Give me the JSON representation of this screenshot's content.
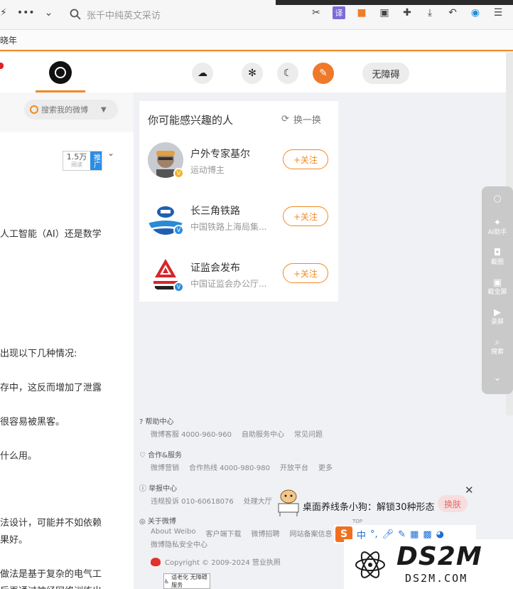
{
  "browser": {
    "address_placeholder": "张千中纯英文采访",
    "bookmark_text": "晓年"
  },
  "header": {
    "accessibility_label": "无障碍"
  },
  "left": {
    "search_placeholder": "搜索我的微博",
    "read_count": "1.5万",
    "read_label": "阅读",
    "promote_label": "推广",
    "article_lines": [
      "人工智能（AI）还是数学",
      "出现以下几种情况:",
      "存中，这反而增加了泄露",
      "很容易被黑客。",
      "什么用。",
      "法设计，可能并不如依赖",
      "果好。",
      "做法是基于复杂的电气工",
      "后再通过神经网络训练出"
    ]
  },
  "recommend": {
    "title": "你可能感兴趣的人",
    "refresh_label": "换一换",
    "follow_label": "+关注",
    "users": [
      {
        "name": "户外专家基尔",
        "desc": "运动博主"
      },
      {
        "name": "长三角铁路",
        "desc": "中国铁路上海局集..."
      },
      {
        "name": "证监会发布",
        "desc": "中国证监会办公厅..."
      }
    ]
  },
  "side_tools": {
    "ai": "AI助手",
    "shot": "截图",
    "shot_full": "截全屏",
    "record": "录屏",
    "search": "搜索"
  },
  "footer": {
    "help_title": "帮助中心",
    "help_links": [
      "微博客服 4000-960-960",
      "自助服务中心",
      "常见问题"
    ],
    "coop_title": "合作&服务",
    "coop_links": [
      "微博营销",
      "合作热线 4000-980-980",
      "开放平台",
      "更多"
    ],
    "report_title": "举报中心",
    "report_links": [
      "违规投诉 010-60618076",
      "处理大厅"
    ],
    "about_title": "关于微博",
    "about_links": [
      "About Weibo",
      "客户端下载",
      "微博招聘",
      "网站备案信息"
    ],
    "privacy": "微博隐私安全中心",
    "copyright": "Copyright © 2009-2024 营业执照",
    "aging_badge": "适老化 无障碍服务"
  },
  "popup": {
    "text": "桌面养线条小狗：解锁30种形态",
    "switch_label": "换肤",
    "close_label": "✕",
    "top_label": "TOP"
  },
  "ime": {
    "logo": "S",
    "chinese": "中"
  },
  "watermark": {
    "brand": "DS2M",
    "domain": "DS2M.COM"
  },
  "colors": {
    "accent": "#f08a24",
    "verified_blue": "#2d8ce0"
  }
}
